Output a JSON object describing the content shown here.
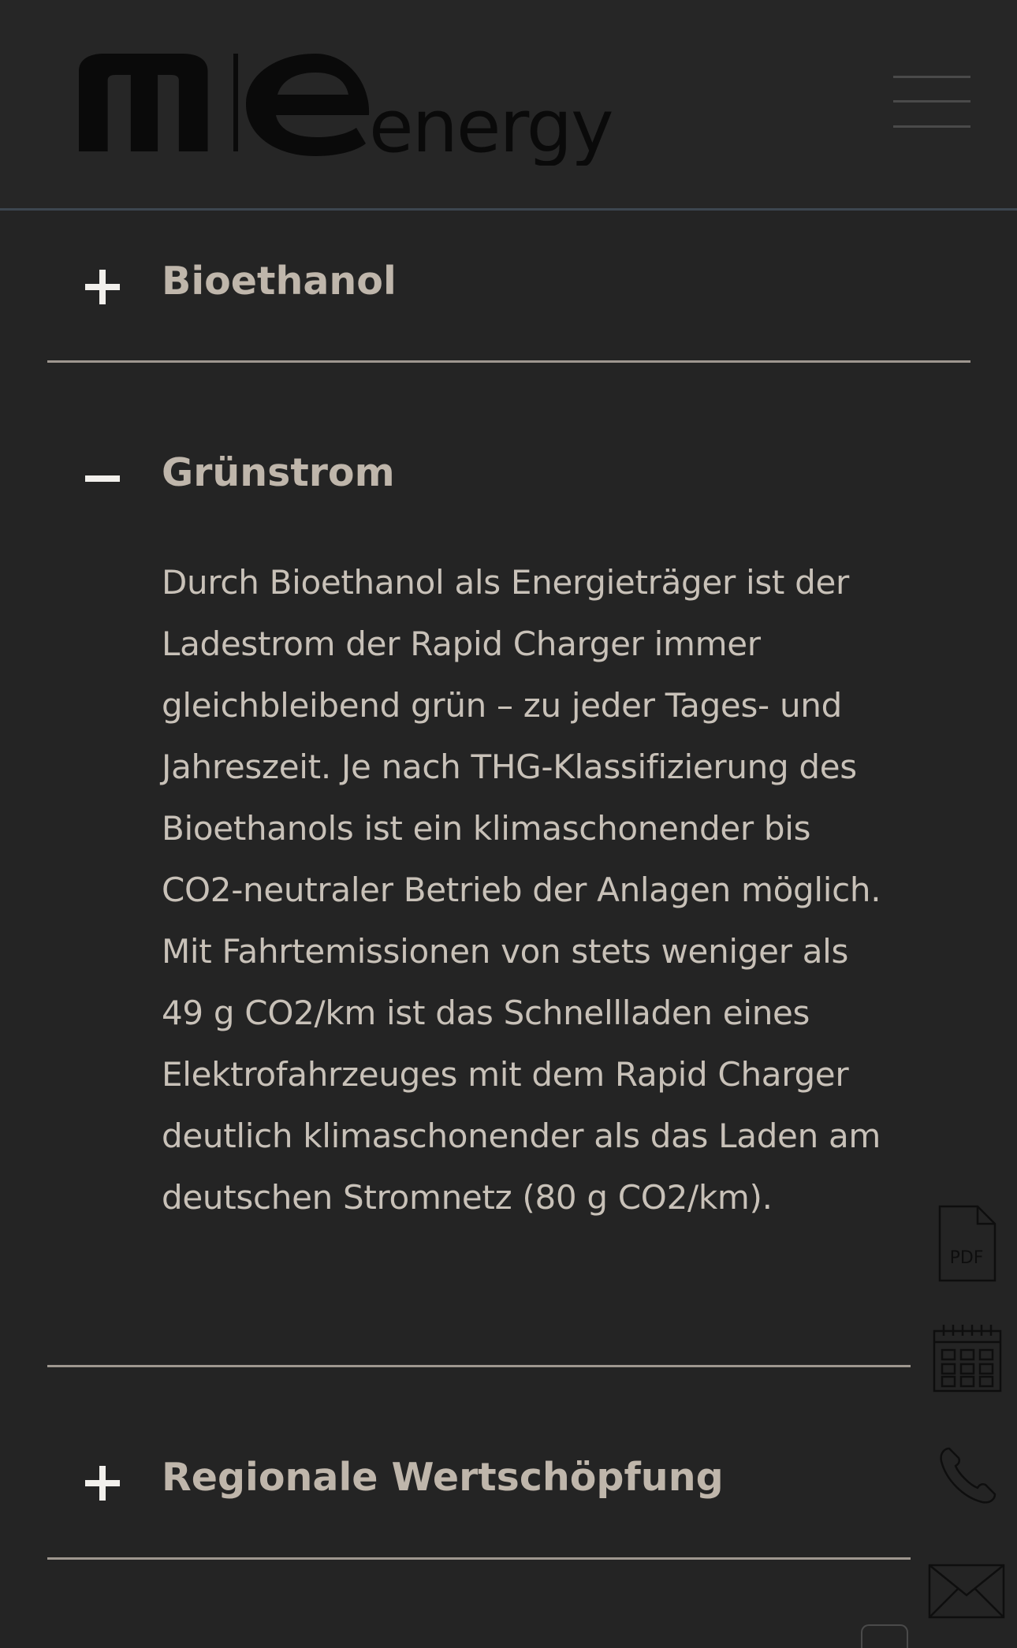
{
  "header": {
    "logo_text": "mle energy"
  },
  "accordion": [
    {
      "title": "Bioethanol",
      "state": "collapsed"
    },
    {
      "title": "Grünstrom",
      "state": "expanded",
      "body": "Durch Bioethanol als Energieträger ist der Ladestrom der Rapid Charger immer gleichbleibend grün – zu jeder Tages- und Jahreszeit. Je nach THG-Klassifizierung des Bioethanols ist ein klimaschonender bis CO2-neutraler Betrieb der Anlagen möglich. Mit Fahrtemissionen von stets weniger als 49 g CO2/km ist das Schnellladen eines Elektrofahrzeuges mit dem Rapid Charger deutlich klimaschonender als das Laden am deutschen Stromnetz (80 g CO2/km)."
    },
    {
      "title": "Regionale Wertschöpfung",
      "state": "collapsed"
    }
  ],
  "side_icons": {
    "pdf_label": "PDF",
    "icons": [
      "pdf-icon",
      "calendar-icon",
      "phone-icon",
      "mail-icon"
    ]
  },
  "colors": {
    "background": "#242424",
    "title": "#bfb6ab",
    "body_text": "#c8c1b8",
    "divider": "#9e978f",
    "logo": "#0a0a0a",
    "header_border": "#3d4650"
  }
}
